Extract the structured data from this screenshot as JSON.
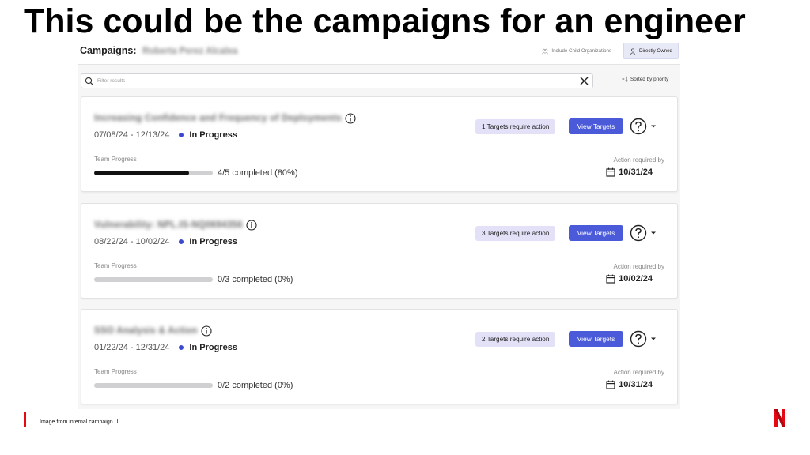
{
  "slide_title": "This could be the campaigns for an engineer",
  "header": {
    "title_label": "Campaigns:",
    "title_name": "Roberta Perez Alcalea",
    "toggles": [
      {
        "label": "Include Child Organizations",
        "active": false,
        "icon": "org-tree-icon"
      },
      {
        "label": "Directly Owned",
        "active": true,
        "icon": "person-icon"
      }
    ]
  },
  "search": {
    "placeholder": "Filter results",
    "value": "",
    "sort_label": "Sorted by priority"
  },
  "campaigns": [
    {
      "name": "Increasing Confidence and Frequency of Deployments",
      "date_range": "07/08/24 - 12/13/24",
      "status": "In Progress",
      "progress_label": "Team Progress",
      "progress_text": "4/5 completed (80%)",
      "progress_fraction": 0.8,
      "targets_badge": "1 Targets require action",
      "view_button": "View Targets",
      "action_label": "Action required by",
      "action_date": "10/31/24"
    },
    {
      "name": "Vulnerability: NPL.IS-NQ0694356",
      "date_range": "08/22/24 - 10/02/24",
      "status": "In Progress",
      "progress_label": "Team Progress",
      "progress_text": "0/3 completed (0%)",
      "progress_fraction": 0.0,
      "targets_badge": "3 Targets require action",
      "view_button": "View Targets",
      "action_label": "Action required by",
      "action_date": "10/02/24"
    },
    {
      "name": "SSO Analysis & Action",
      "date_range": "01/22/24 - 12/31/24",
      "status": "In Progress",
      "progress_label": "Team Progress",
      "progress_text": "0/2 completed (0%)",
      "progress_fraction": 0.0,
      "targets_badge": "2 Targets require action",
      "view_button": "View Targets",
      "action_label": "Action required by",
      "action_date": "10/31/24"
    }
  ],
  "footer": {
    "caption": "Image from internal campaign UI"
  },
  "colors": {
    "accent": "#4a5ad8",
    "status_dot": "#3b49cf",
    "badge_bg": "#e3e1f7",
    "brand_red": "#e50914"
  }
}
